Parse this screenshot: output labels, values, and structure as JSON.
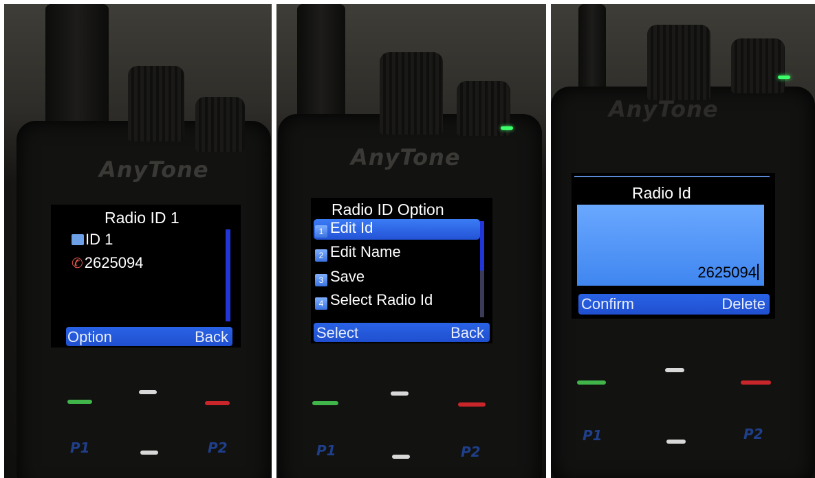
{
  "brand": "AnyTone",
  "panels": [
    {
      "title": "Radio ID 1",
      "id_line": "ID 1",
      "number": "2625094",
      "softkeys": {
        "left": "Option",
        "right": "Back"
      }
    },
    {
      "title": "Radio ID Option",
      "menu": [
        {
          "index": "1",
          "label": "Edit Id",
          "selected": true
        },
        {
          "index": "2",
          "label": "Edit Name",
          "selected": false
        },
        {
          "index": "3",
          "label": "Save",
          "selected": false
        },
        {
          "index": "4",
          "label": "Select Radio Id",
          "selected": false
        }
      ],
      "softkeys": {
        "left": "Select",
        "right": "Back"
      }
    },
    {
      "title": "Radio Id",
      "input_value": "2625094",
      "softkeys": {
        "left": "Confirm",
        "right": "Delete"
      }
    }
  ],
  "keys": {
    "p1": "P1",
    "p2": "P2"
  },
  "colors": {
    "softbar": "#1f4fcf",
    "selection": "#2353d6",
    "input": "#3f86f0",
    "led_green": "#3cff6a",
    "key_red": "#c8262a",
    "phone_icon": "#e0554b"
  }
}
